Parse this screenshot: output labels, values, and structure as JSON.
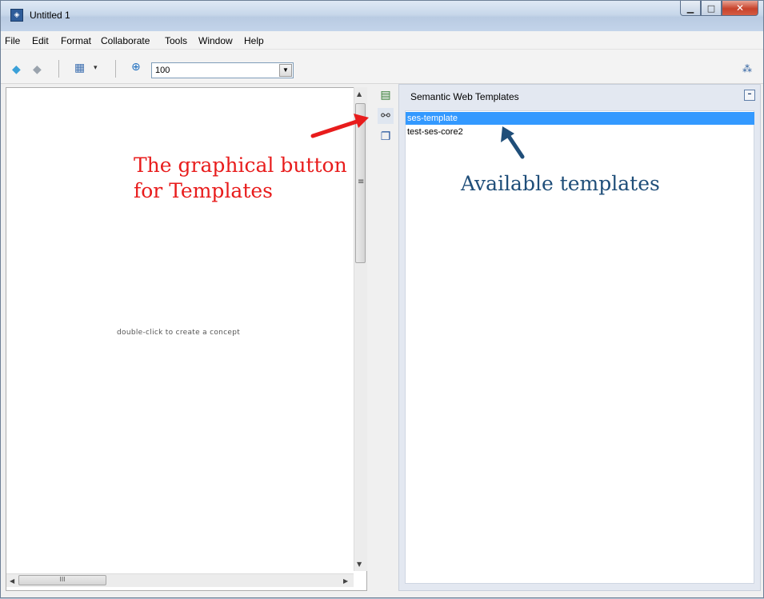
{
  "window": {
    "title": "Untitled 1"
  },
  "menu": [
    {
      "label": "File"
    },
    {
      "label": "Edit"
    },
    {
      "label": "Format"
    },
    {
      "label": "Collaborate"
    },
    {
      "label": "Tools"
    },
    {
      "label": "Window"
    },
    {
      "label": "Help"
    }
  ],
  "toolbar": {
    "zoom_value": "100"
  },
  "canvas": {
    "hint": "double-click to create a concept",
    "hscroll_grip": "III",
    "vscroll_grip": "≡"
  },
  "panel": {
    "title": "Semantic Web Templates",
    "items": [
      {
        "label": "ses-template",
        "selected": true
      },
      {
        "label": "test-ses-core2",
        "selected": false
      }
    ]
  },
  "annotations": {
    "button_note_line1": "The graphical button",
    "button_note_line2": "for Templates",
    "templates_note": "Available templates",
    "red_color": "#e81c1c",
    "blue_color": "#1f4e79"
  },
  "icons": [
    "app-icon",
    "back-arrow-icon",
    "forward-arrow-icon",
    "view-icon",
    "zoom-icon",
    "help-icon",
    "notes-icon",
    "templates-icon",
    "documents-icon"
  ]
}
